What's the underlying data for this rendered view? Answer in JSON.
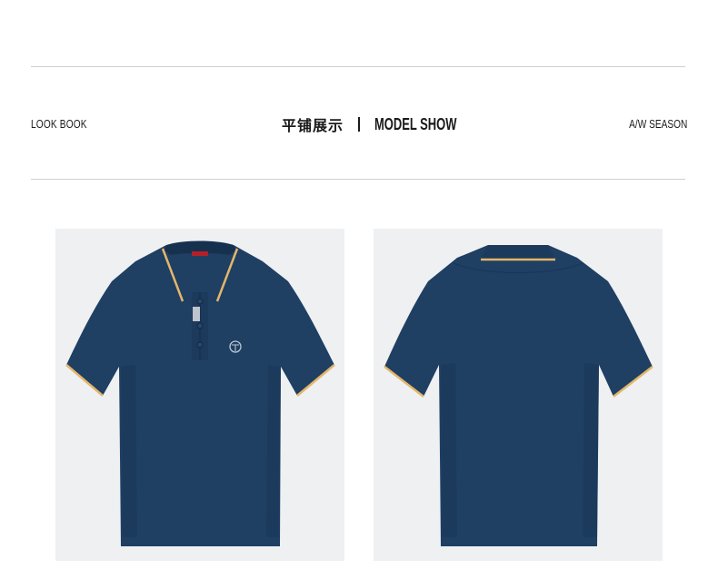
{
  "header": {
    "left_label": "LOOK BOOK",
    "title_cn": "平铺展示",
    "title_en": "MODEL SHOW",
    "right_label": "A/W SEASON"
  },
  "products": [
    {
      "view": "front",
      "color": "#1f3f63",
      "trim_color": "#e3b66a"
    },
    {
      "view": "back",
      "color": "#1f3f63",
      "trim_color": "#e3b66a"
    }
  ]
}
